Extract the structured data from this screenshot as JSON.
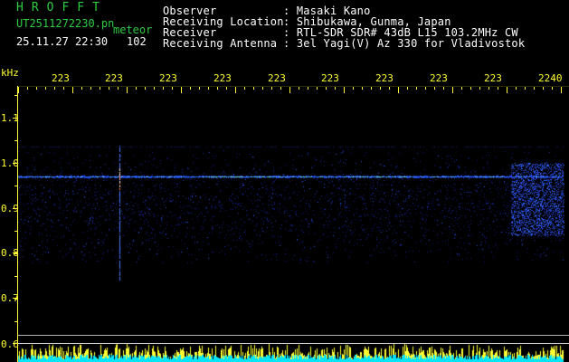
{
  "header": {
    "brand": "HROFFT",
    "filename": "UT2511272230.pn",
    "label": "meteor",
    "datetime": "25.11.27 22:30",
    "count": "102",
    "fields": [
      {
        "label": "Observer",
        "value": ": Masaki Kano"
      },
      {
        "label": "Receiving Location",
        "value": ": Shibukawa, Gunma, Japan"
      },
      {
        "label": "Receiver",
        "value": ": RTL-SDR SDR# 43dB L15 103.2MHz CW"
      },
      {
        "label": "Receiving Antenna",
        "value": ": 3el Yagi(V) Az 330 for Vladivostok"
      }
    ]
  },
  "axis": {
    "unit": "kHz",
    "y_ticks": [
      "1.1",
      "1.0",
      "0.9",
      "0.8",
      "0.7",
      "0.6"
    ],
    "x_ticks": [
      "223",
      "223",
      "223",
      "223",
      "223",
      "223",
      "223",
      "223",
      "223",
      "2240"
    ]
  },
  "colors": {
    "background": "#000000",
    "text": "#ffffff",
    "accent_green": "#2ecc40",
    "axis_yellow": "#ffff33",
    "signal_blue": "#1e3cff",
    "baseline_cyan": "#00e5ff"
  }
}
